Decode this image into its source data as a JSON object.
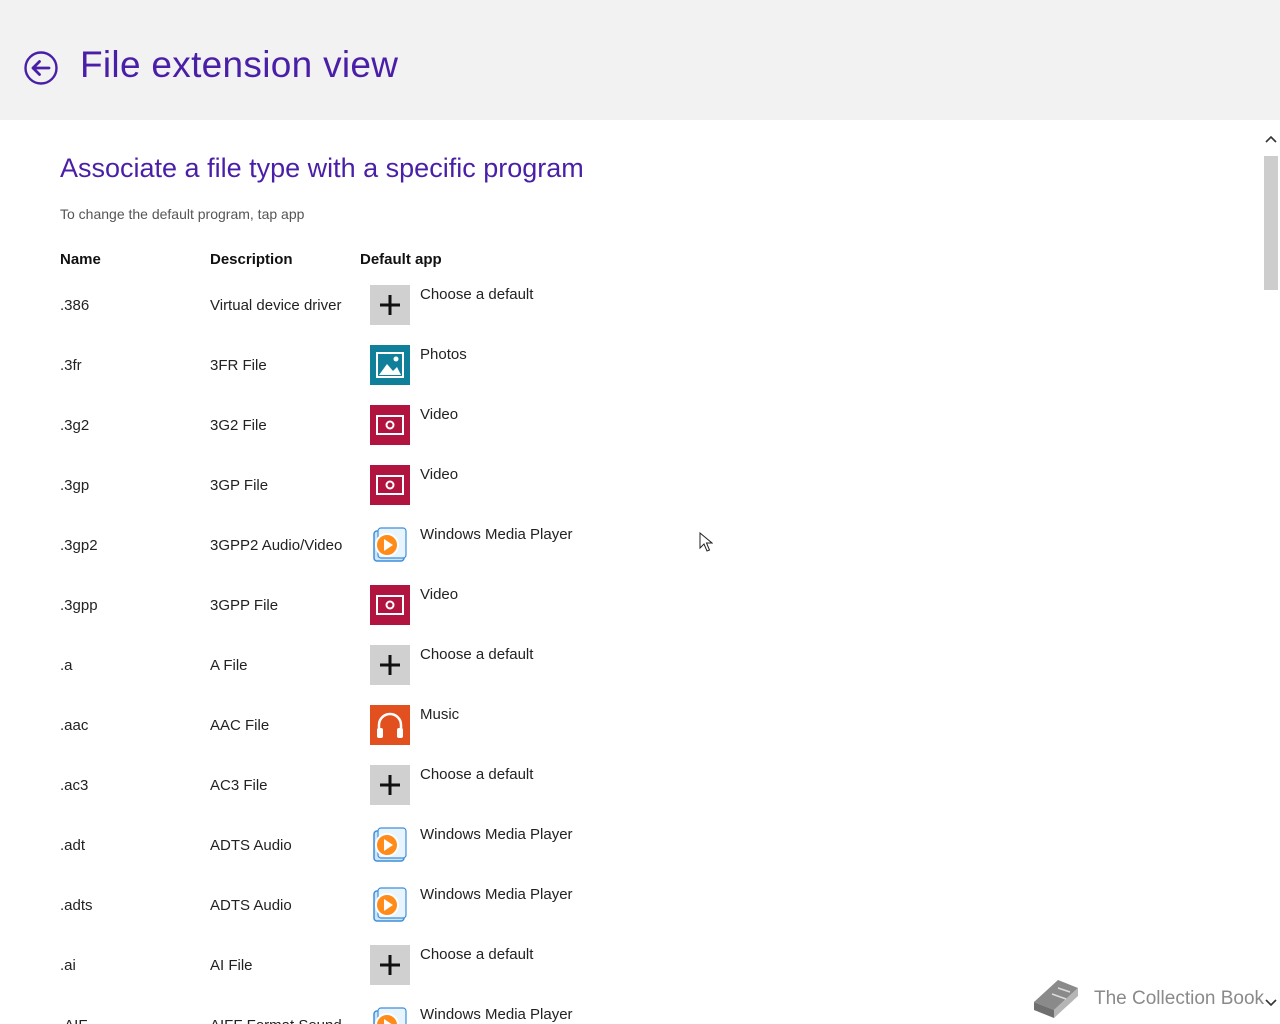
{
  "header": {
    "title": "File extension view",
    "back_icon": "back-arrow-circle-icon"
  },
  "section": {
    "title": "Associate a file type with a specific program",
    "hint": "To change the default program, tap app"
  },
  "columns": {
    "name": "Name",
    "description": "Description",
    "default_app": "Default app"
  },
  "app_colors": {
    "choose": "#d0d0d0",
    "photos": "#0f7f9a",
    "video": "#b0143f",
    "music": "#e2501f",
    "wmp": "#3f8fd8",
    "accent": "#4a1fa8"
  },
  "rows": [
    {
      "name": ".386",
      "description": "Virtual device driver",
      "app": "Choose a default",
      "icon": "plus-icon"
    },
    {
      "name": ".3fr",
      "description": "3FR File",
      "app": "Photos",
      "icon": "photos-icon"
    },
    {
      "name": ".3g2",
      "description": "3G2 File",
      "app": "Video",
      "icon": "video-icon"
    },
    {
      "name": ".3gp",
      "description": "3GP File",
      "app": "Video",
      "icon": "video-icon"
    },
    {
      "name": ".3gp2",
      "description": "3GPP2 Audio/Video",
      "app": "Windows Media Player",
      "icon": "windows-media-player-icon"
    },
    {
      "name": ".3gpp",
      "description": "3GPP File",
      "app": "Video",
      "icon": "video-icon"
    },
    {
      "name": ".a",
      "description": "A File",
      "app": "Choose a default",
      "icon": "plus-icon"
    },
    {
      "name": ".aac",
      "description": "AAC File",
      "app": "Music",
      "icon": "music-icon"
    },
    {
      "name": ".ac3",
      "description": "AC3 File",
      "app": "Choose a default",
      "icon": "plus-icon"
    },
    {
      "name": ".adt",
      "description": "ADTS Audio",
      "app": "Windows Media Player",
      "icon": "windows-media-player-icon"
    },
    {
      "name": ".adts",
      "description": "ADTS Audio",
      "app": "Windows Media Player",
      "icon": "windows-media-player-icon"
    },
    {
      "name": ".ai",
      "description": "AI File",
      "app": "Choose a default",
      "icon": "plus-icon"
    },
    {
      "name": ".AIF",
      "description": "AIFF Format Sound",
      "app": "Windows Media Player",
      "icon": "windows-media-player-icon"
    }
  ],
  "watermark": {
    "text": "The Collection Book",
    "icon": "book-icon"
  }
}
